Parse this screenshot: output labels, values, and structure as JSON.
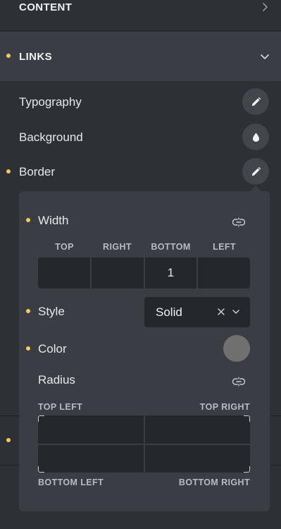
{
  "sections": {
    "content": {
      "title": "CONTENT"
    },
    "links": {
      "title": "LINKS"
    }
  },
  "rows": {
    "typography": {
      "label": "Typography",
      "icon": "pencil-icon"
    },
    "background": {
      "label": "Background",
      "icon": "droplet-icon"
    },
    "border": {
      "label": "Border",
      "icon": "pencil-icon"
    }
  },
  "border_popover": {
    "width": {
      "label": "Width",
      "sides": [
        "TOP",
        "RIGHT",
        "BOTTOM",
        "LEFT"
      ],
      "values": [
        "",
        "",
        "1",
        ""
      ],
      "link_icon": "unlink-icon"
    },
    "style": {
      "label": "Style",
      "value": "Solid"
    },
    "color": {
      "label": "Color",
      "value": "#707070"
    },
    "radius": {
      "label": "Radius",
      "top_left": "TOP LEFT",
      "top_right": "TOP RIGHT",
      "bottom_left": "BOTTOM LEFT",
      "bottom_right": "BOTTOM RIGHT",
      "values": [
        "",
        "",
        "",
        ""
      ],
      "link_icon": "unlink-icon"
    }
  },
  "colors": {
    "accent_dot": "#f2cb5b",
    "panel_bg": "#2d3035",
    "popover_bg": "#3a3e44",
    "input_bg": "#24272c"
  }
}
